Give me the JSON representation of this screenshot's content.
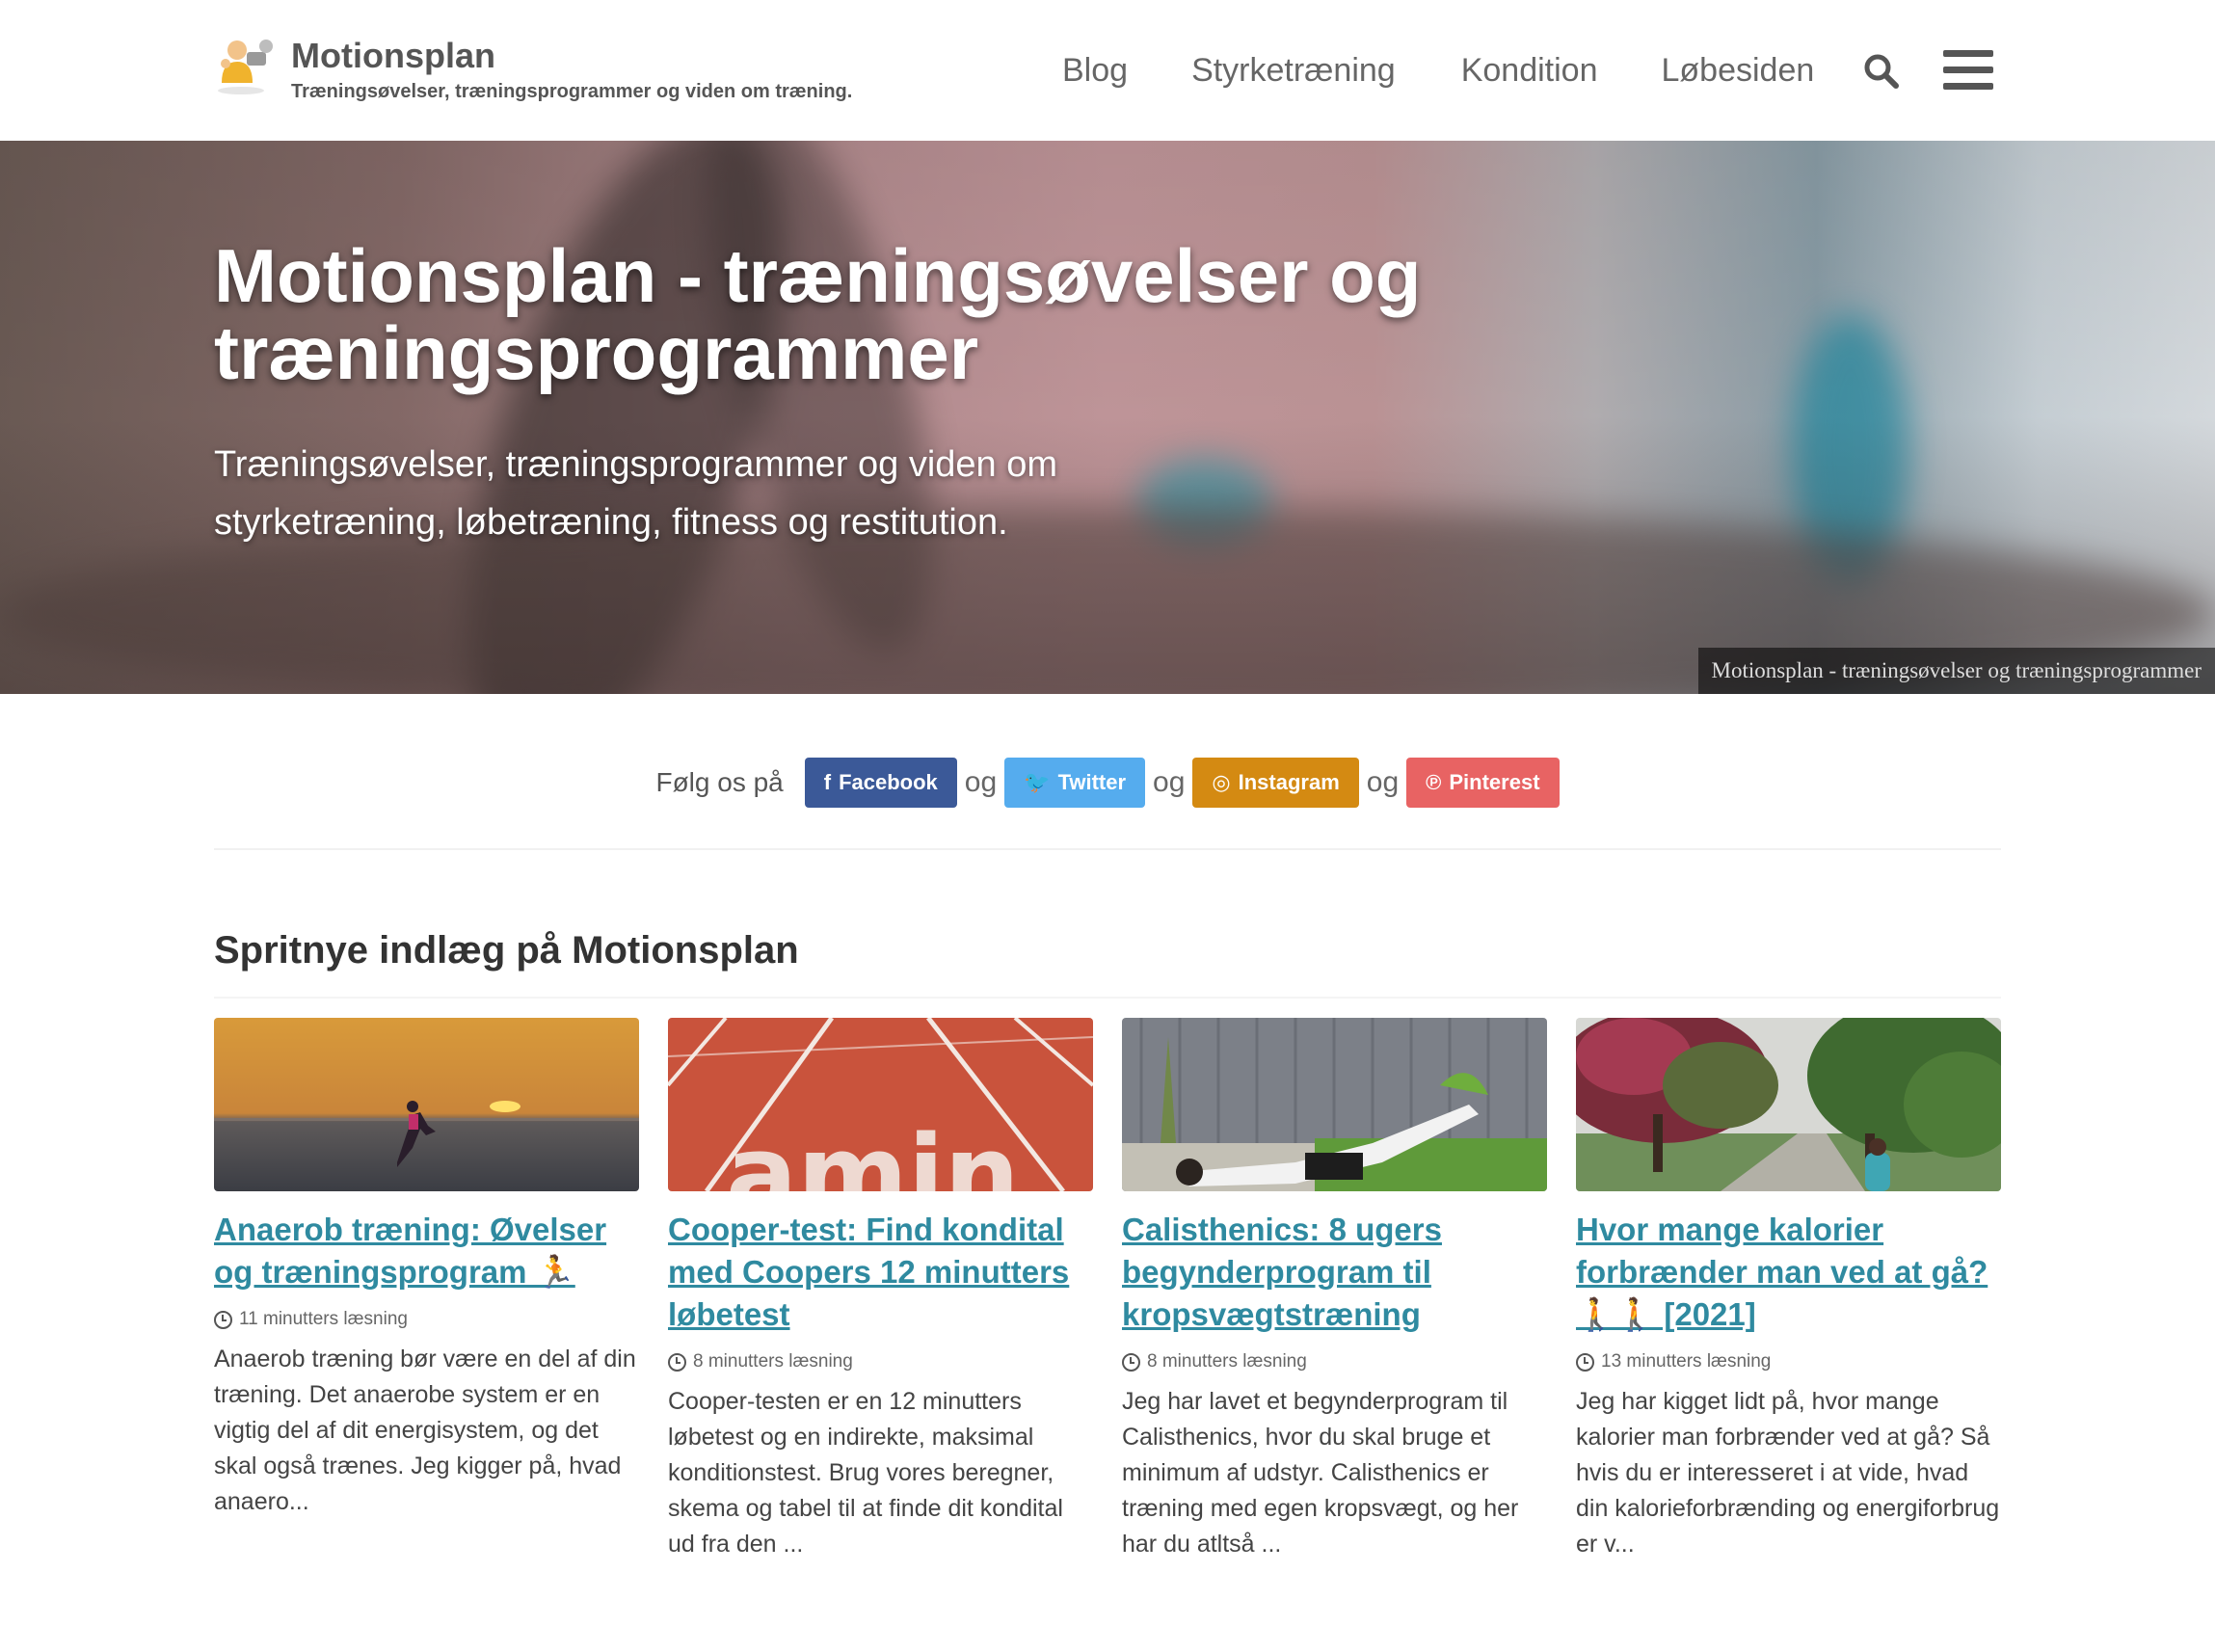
{
  "header": {
    "site_title": "Motionsplan",
    "tagline": "Træningsøvelser, træningsprogrammer og viden om træning.",
    "nav": [
      {
        "label": "Blog"
      },
      {
        "label": "Styrketræning"
      },
      {
        "label": "Kondition"
      },
      {
        "label": "Løbesiden"
      }
    ],
    "icons": {
      "search": "search-icon",
      "menu": "hamburger-menu-icon"
    }
  },
  "hero": {
    "title": "Motionsplan - træningsøvelser og træningsprogrammer",
    "subtitle": "Træningsøvelser, træningsprogrammer og viden om styrketræning, løbetræning, fitness og restitution.",
    "caption": "Motionsplan - træningsøvelser og træningsprogrammer"
  },
  "follow": {
    "lead": "Følg os på",
    "separator": "og",
    "buttons": [
      {
        "label": "Facebook",
        "color": "#3b5998"
      },
      {
        "label": "Twitter",
        "color": "#55acee"
      },
      {
        "label": "Instagram",
        "color": "#d48a12"
      },
      {
        "label": "Pinterest",
        "color": "#e86363"
      }
    ]
  },
  "posts": {
    "section_title": "Spritnye indlæg på Motionsplan",
    "items": [
      {
        "title": "Anaerob træning: Øvelser og træningsprogram 🏃",
        "reading_time": "11 minutters læsning",
        "excerpt": "Anaerob træning bør være en del af din træning. Det anaerobe system er en vigtig del af dit energisystem, og det skal også trænes. Jeg kigger på, hvad anaero..."
      },
      {
        "title": "Cooper-test: Find kondital med Coopers 12 minutters løbetest",
        "reading_time": "8 minutters læsning",
        "excerpt": "Cooper-testen er en 12 minutters løbetest og en indirekte, maksimal konditionstest. Brug vores beregner, skema og tabel til at finde dit kondital ud fra den ..."
      },
      {
        "title": "Calisthenics: 8 ugers begynderprogram til kropsvægtstræning",
        "reading_time": "8 minutters læsning",
        "excerpt": "Jeg har lavet et begynderprogram til Calisthenics, hvor du skal bruge et minimum af udstyr. Calisthenics er træning med egen kropsvægt, og her har du atltså ..."
      },
      {
        "title": "Hvor mange kalorier forbrænder man ved at gå? 🚶🚶 [2021]",
        "reading_time": "13 minutters læsning",
        "excerpt": "Jeg har kigget lidt på, hvor mange kalorier man forbrænder ved at gå? Så hvis du er interesseret i at vide, hvad din kalorieforbrænding og energiforbrug er v..."
      }
    ]
  }
}
